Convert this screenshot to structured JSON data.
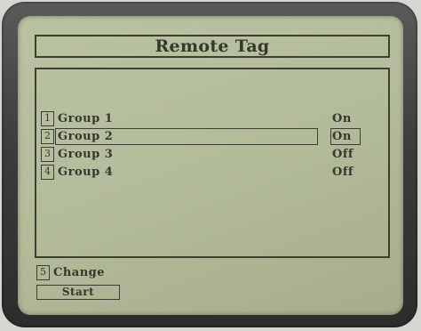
{
  "screen": {
    "title": "Remote Tag"
  },
  "groups": [
    {
      "number": "1",
      "label": "Group 1",
      "status": "On"
    },
    {
      "number": "2",
      "label": "Group 2",
      "status": "On",
      "selected": true
    },
    {
      "number": "3",
      "label": "Group 3",
      "status": "Off"
    },
    {
      "number": "4",
      "label": "Group 4",
      "status": "Off"
    }
  ],
  "actions": {
    "change_number": "5",
    "change_label": "Change",
    "start_label": "Start"
  },
  "colors": {
    "lcd_background": "#b6bf9d",
    "lcd_ink": "#35362c",
    "bezel": "#3d3c3b"
  }
}
